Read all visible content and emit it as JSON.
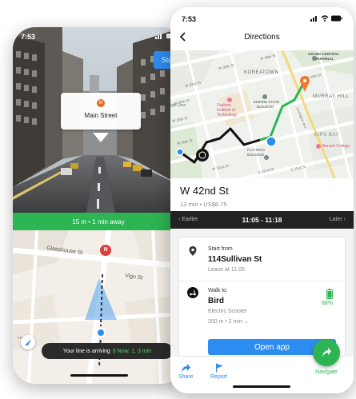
{
  "ar_screen": {
    "status_time": "7:53",
    "stop_label": "Stop",
    "card_title": "Main Street",
    "card_pin_letter": "M",
    "distance_bar": "15 m • 1 min away",
    "map_labels": [
      "Glasshouse St",
      "Vigo St",
      "Legal"
    ],
    "map_marker_letter": "N",
    "toast_text": "Your line is arriving",
    "toast_highlight": "6 Now, 1, 3 min",
    "accent_green": "#2db553",
    "accent_blue": "#2d8cf0"
  },
  "directions": {
    "status_time": "7:53",
    "header_title": "Directions",
    "map_labels": {
      "koreatown": "KOREATOWN",
      "grand_central": "GRAND CENTRAL",
      "terminal": "TERMINAL",
      "murray_hill": "MURRAY HILL",
      "kips_bay": "KIPS BAY",
      "fashion_1": "Fashion",
      "fashion_2": "Institute of",
      "fashion_3": "Technology",
      "empire_1": "EMPIRE STATE",
      "empire_2": "BUILDING",
      "flatiron_1": "FLATIRON",
      "flatiron_2": "BUILDING",
      "baruch": "Baruch College",
      "high_line": "igh Line",
      "st_w38": "W 38th St",
      "st_w35": "W 35th St",
      "st_w33": "W 33rd St",
      "st_w30": "W 30th St",
      "st_w28": "W 28th St",
      "st_w26": "W 26th St",
      "st_w22": "W 22nd St",
      "st_e34": "E 34th St",
      "st_e23": "E 23rd St",
      "st_e22": "E 22nd St",
      "st_lexington": "Lexington Ave"
    },
    "destination": "W 42nd St",
    "summary": "13 min • US$6.75",
    "time_bar": {
      "earlier": "Earlier",
      "range": "11:05 - 11:18",
      "later": "Later"
    },
    "steps": [
      {
        "label": "Start from",
        "title": "114Sullivan St",
        "meta": "Leave at 11:05",
        "icon": "pin-icon"
      },
      {
        "label": "Walk to",
        "title": "Bird",
        "meta": "Electric Scooter",
        "meta2": "200 m • 2 min",
        "battery": "88%",
        "icon": "scooter-icon"
      }
    ],
    "open_app_label": "Open app",
    "actions": {
      "share": "Share",
      "report": "Report",
      "navigate": "Navigate"
    },
    "route_green": "#2db553",
    "route_black": "#111111"
  }
}
